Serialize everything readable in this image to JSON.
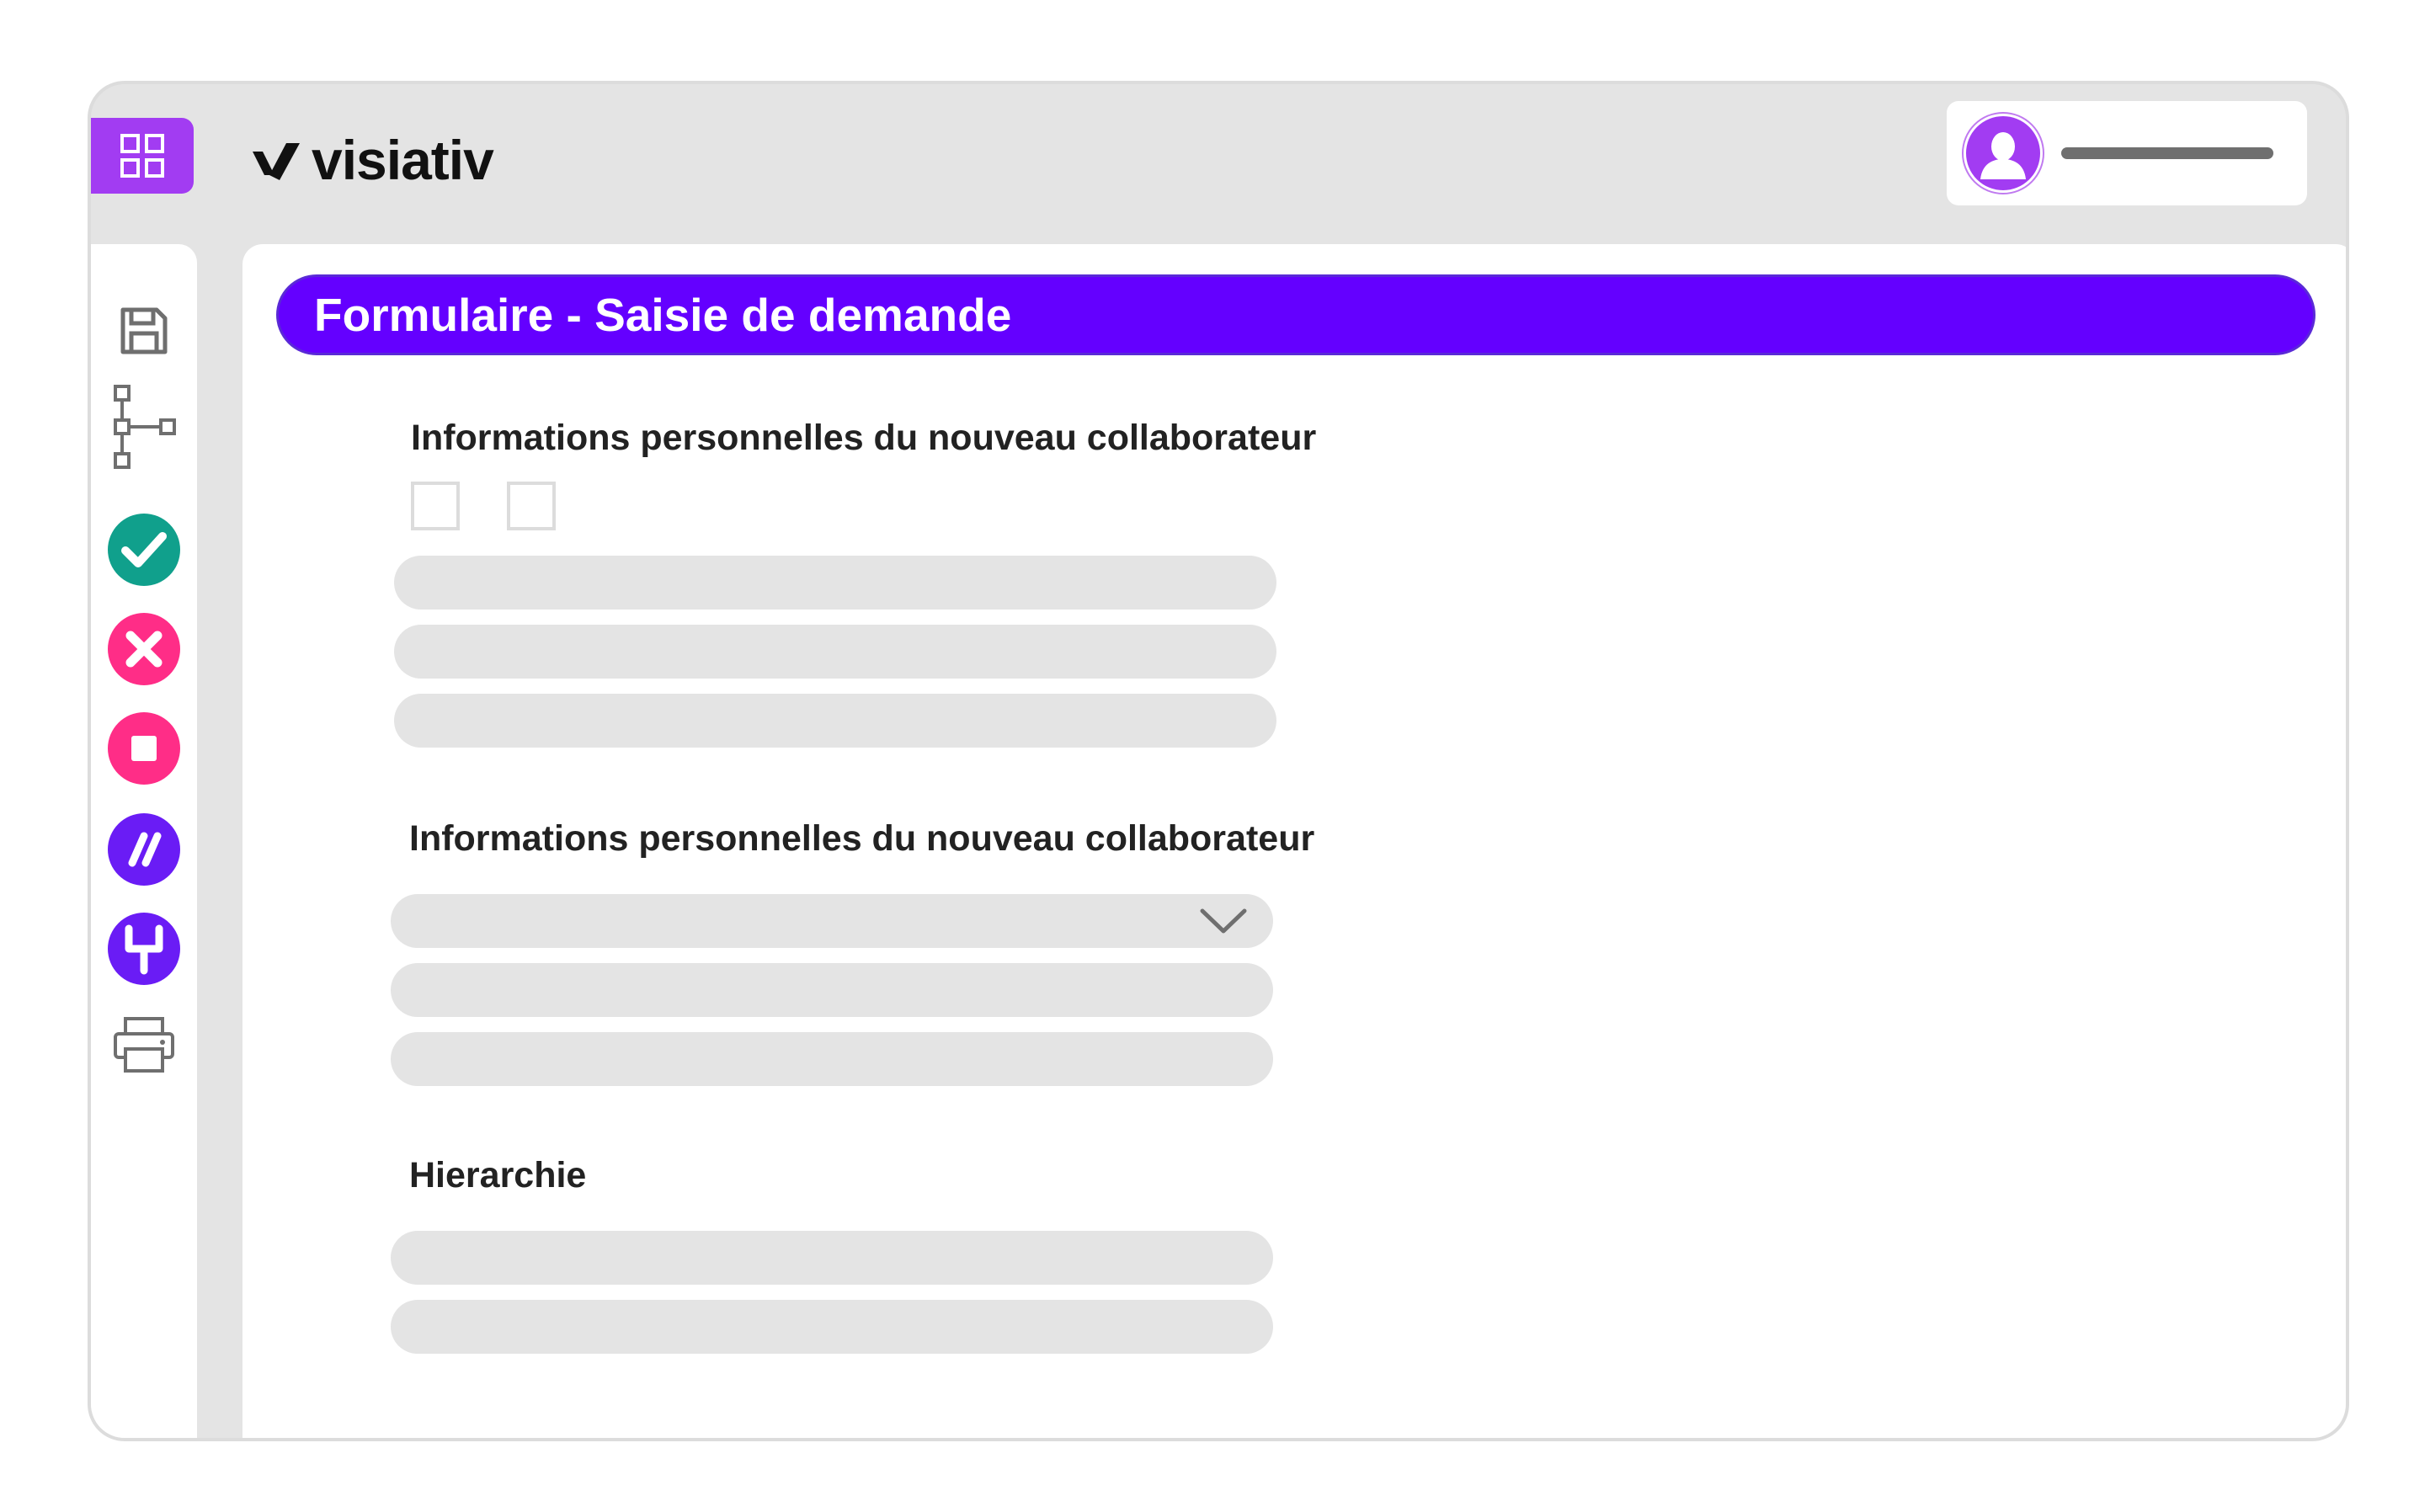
{
  "brand": {
    "name": "visiativ",
    "accent_color": "#6400ff",
    "apps_button_color": "#a23cf2"
  },
  "header": {
    "apps_icon": "grid-icon",
    "user_avatar_icon": "user-avatar-icon"
  },
  "sidebar": {
    "items": [
      {
        "icon": "save-icon"
      },
      {
        "icon": "workflow-tree-icon"
      },
      {
        "icon": "approve-check-icon",
        "color": "#10a08c"
      },
      {
        "icon": "reject-x-icon",
        "color": "#ff2d87"
      },
      {
        "icon": "stop-icon",
        "color": "#ff2d87"
      },
      {
        "icon": "slashes-icon",
        "color": "#6a1cf5"
      },
      {
        "icon": "merge-icon",
        "color": "#6a1cf5"
      },
      {
        "icon": "print-icon"
      }
    ]
  },
  "form": {
    "title": "Formulaire - Saisie de demande",
    "sections": [
      {
        "title": "Informations personnelles du nouveau collaborateur"
      },
      {
        "title": "Informations personnelles du nouveau collaborateur"
      },
      {
        "title": "Hierarchie"
      }
    ]
  }
}
